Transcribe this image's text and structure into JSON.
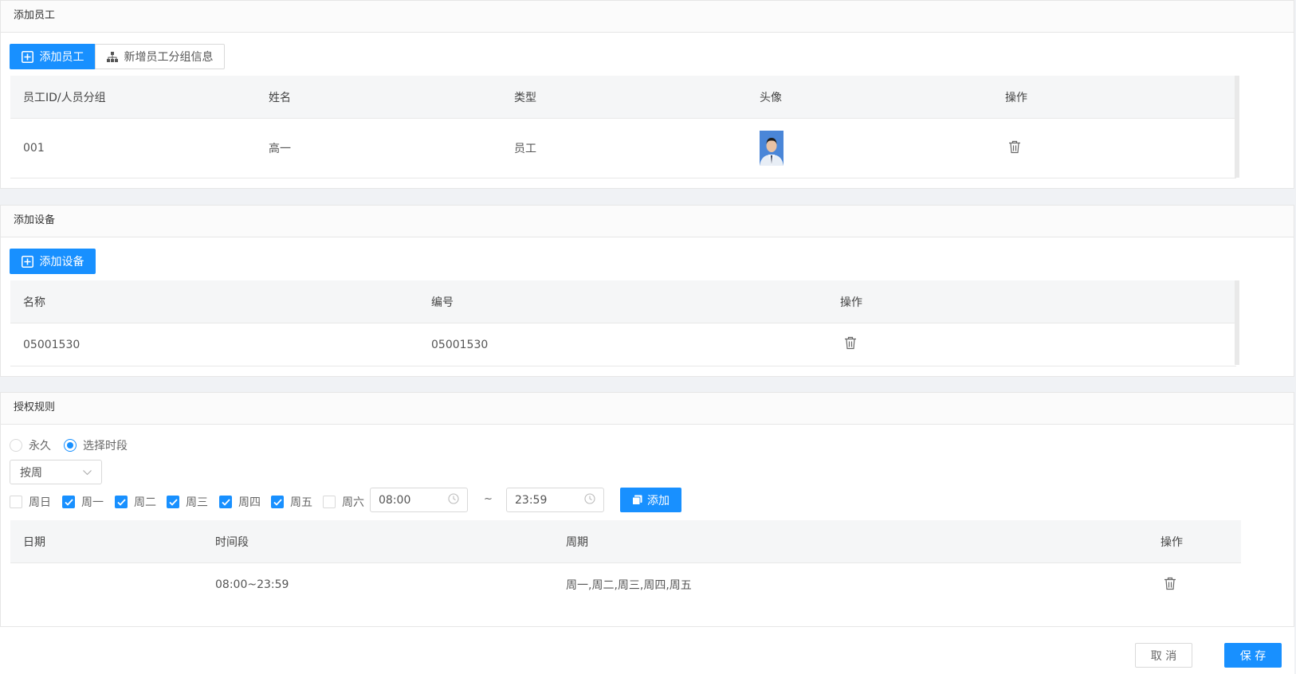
{
  "employee_section": {
    "title": "添加员工",
    "add_button": "添加员工",
    "group_button": "新增员工分组信息",
    "columns": [
      "员工ID/人员分组",
      "姓名",
      "类型",
      "头像",
      "操作"
    ],
    "rows": [
      {
        "id": "001",
        "name": "高一",
        "type": "员工"
      }
    ]
  },
  "device_section": {
    "title": "添加设备",
    "add_button": "添加设备",
    "columns": [
      "名称",
      "编号",
      "操作"
    ],
    "rows": [
      {
        "name": "05001530",
        "code": "05001530"
      }
    ]
  },
  "rule_section": {
    "title": "授权规则",
    "radio_permanent": "永久",
    "radio_period": "选择时段",
    "selected_radio": "选择时段",
    "period_select": "按周",
    "weekdays": [
      {
        "label": "周日",
        "checked": false
      },
      {
        "label": "周一",
        "checked": true
      },
      {
        "label": "周二",
        "checked": true
      },
      {
        "label": "周三",
        "checked": true
      },
      {
        "label": "周四",
        "checked": true
      },
      {
        "label": "周五",
        "checked": true
      },
      {
        "label": "周六",
        "checked": false
      }
    ],
    "start_time": "08:00",
    "end_time": "23:59",
    "tilde": "~",
    "add_button": "添加",
    "columns": [
      "日期",
      "时间段",
      "周期",
      "操作"
    ],
    "rows": [
      {
        "date": "",
        "time_range": "08:00~23:59",
        "cycle": "周一,周二,周三,周四,周五"
      }
    ]
  },
  "footer": {
    "cancel": "取 消",
    "save": "保 存"
  },
  "colors": {
    "primary": "#1890ff",
    "border": "#e6e6e6",
    "header_bg": "#f5f6f7"
  }
}
